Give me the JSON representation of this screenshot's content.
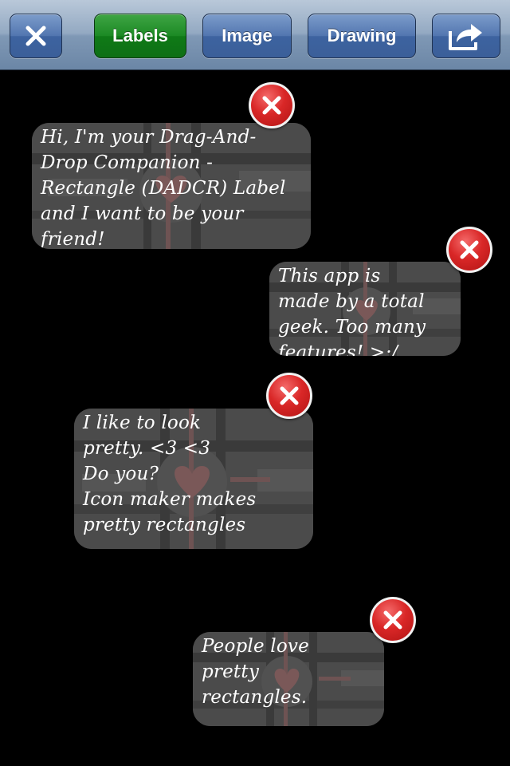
{
  "toolbar": {
    "close_icon": "close-x-icon",
    "tabs": [
      {
        "label": "Labels",
        "selected": true
      },
      {
        "label": "Image",
        "selected": false
      },
      {
        "label": "Drawing",
        "selected": false
      }
    ],
    "share_icon": "share-export-icon",
    "colors": {
      "toolbar": "#8aa1bd",
      "button": "#4a6ea9",
      "selected_button": "#1a8a22"
    }
  },
  "labels": [
    {
      "text": "Hi, I'm your Drag-And-\nDrop Companion -\nRectangle (DADCR) Label\nand I want to be your\nfriend!",
      "delete_label": "X"
    },
    {
      "text": "This app is\nmade by a total\ngeek. Too many\nfeatures! >:/",
      "delete_label": "X"
    },
    {
      "text": "I like to look\npretty. <3 <3\nDo you?\nIcon maker makes\npretty rectangles",
      "delete_label": "X"
    },
    {
      "text": "People love\npretty\nrectangles.",
      "delete_label": "X"
    }
  ],
  "colors": {
    "background": "#000000",
    "label_fill": "#4a4a4a",
    "heart": "#7a5858",
    "delete": "#d92727"
  }
}
